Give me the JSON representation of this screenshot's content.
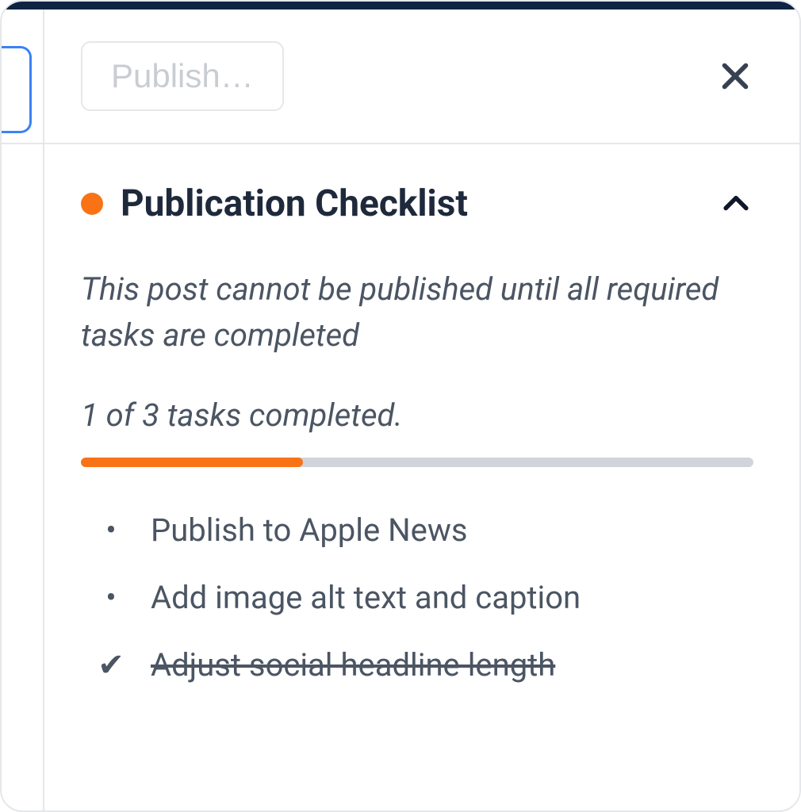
{
  "header": {
    "publish_label": "Publish…"
  },
  "checklist": {
    "title": "Publication Checklist",
    "status_color": "#f97316",
    "warning": "This post cannot be published until all required tasks are completed",
    "progress_text": "1 of 3 tasks completed.",
    "progress_percent": 33,
    "tasks": [
      {
        "label": "Publish to Apple News",
        "done": false
      },
      {
        "label": "Add image alt text and caption",
        "done": false
      },
      {
        "label": "Adjust social headline length",
        "done": true
      }
    ]
  }
}
